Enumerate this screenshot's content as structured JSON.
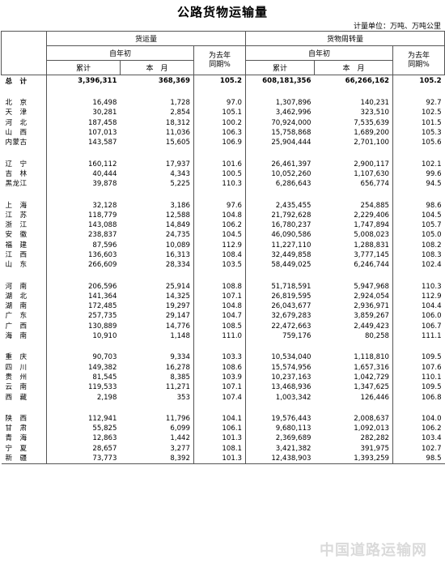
{
  "title": "公路货物运输量",
  "unit": "计量单位：万吨、万吨公里",
  "headers": {
    "freight": "货运量",
    "turnover": "货物周转量",
    "ytd_top": "自年初",
    "ytd_bottom": "累计",
    "month": "本　月",
    "yoy_top": "为去年",
    "yoy_bottom": "同期%"
  },
  "total": {
    "name": "总　计",
    "c1": "3,396,311",
    "c2": "368,369",
    "c3": "105.2",
    "c4": "608,181,356",
    "c5": "66,266,162",
    "c6": "105.2"
  },
  "groups": [
    [
      {
        "name": "北　京",
        "c1": "16,498",
        "c2": "1,728",
        "c3": "97.0",
        "c4": "1,307,896",
        "c5": "140,231",
        "c6": "92.7"
      },
      {
        "name": "天　津",
        "c1": "30,281",
        "c2": "2,854",
        "c3": "105.1",
        "c4": "3,462,996",
        "c5": "323,510",
        "c6": "102.5"
      },
      {
        "name": "河　北",
        "c1": "187,458",
        "c2": "18,312",
        "c3": "100.2",
        "c4": "70,924,000",
        "c5": "7,535,639",
        "c6": "101.5"
      },
      {
        "name": "山　西",
        "c1": "107,013",
        "c2": "11,036",
        "c3": "106.3",
        "c4": "15,758,868",
        "c5": "1,689,200",
        "c6": "105.3"
      },
      {
        "name": "内蒙古",
        "c1": "143,587",
        "c2": "15,605",
        "c3": "106.9",
        "c4": "25,904,444",
        "c5": "2,701,100",
        "c6": "105.6"
      }
    ],
    [
      {
        "name": "辽　宁",
        "c1": "160,112",
        "c2": "17,937",
        "c3": "101.6",
        "c4": "26,461,397",
        "c5": "2,900,117",
        "c6": "102.1"
      },
      {
        "name": "吉　林",
        "c1": "40,444",
        "c2": "4,343",
        "c3": "100.5",
        "c4": "10,052,260",
        "c5": "1,107,630",
        "c6": "99.6"
      },
      {
        "name": "黑龙江",
        "c1": "39,878",
        "c2": "5,225",
        "c3": "110.3",
        "c4": "6,286,643",
        "c5": "656,774",
        "c6": "94.5"
      }
    ],
    [
      {
        "name": "上　海",
        "c1": "32,128",
        "c2": "3,186",
        "c3": "97.6",
        "c4": "2,435,455",
        "c5": "254,885",
        "c6": "98.6"
      },
      {
        "name": "江　苏",
        "c1": "118,779",
        "c2": "12,588",
        "c3": "104.8",
        "c4": "21,792,628",
        "c5": "2,229,406",
        "c6": "104.5"
      },
      {
        "name": "浙　江",
        "c1": "143,088",
        "c2": "14,849",
        "c3": "106.2",
        "c4": "16,780,237",
        "c5": "1,747,894",
        "c6": "105.7"
      },
      {
        "name": "安　徽",
        "c1": "238,837",
        "c2": "24,735",
        "c3": "104.5",
        "c4": "46,090,586",
        "c5": "5,008,023",
        "c6": "105.0"
      },
      {
        "name": "福　建",
        "c1": "87,596",
        "c2": "10,089",
        "c3": "112.9",
        "c4": "11,227,110",
        "c5": "1,288,831",
        "c6": "108.2"
      },
      {
        "name": "江　西",
        "c1": "136,603",
        "c2": "16,313",
        "c3": "108.4",
        "c4": "32,449,858",
        "c5": "3,777,145",
        "c6": "108.3"
      },
      {
        "name": "山　东",
        "c1": "266,609",
        "c2": "28,334",
        "c3": "103.5",
        "c4": "58,449,025",
        "c5": "6,246,744",
        "c6": "102.4"
      }
    ],
    [
      {
        "name": "河　南",
        "c1": "206,596",
        "c2": "25,914",
        "c3": "108.8",
        "c4": "51,718,591",
        "c5": "5,947,968",
        "c6": "110.3"
      },
      {
        "name": "湖　北",
        "c1": "141,364",
        "c2": "14,325",
        "c3": "107.1",
        "c4": "26,819,595",
        "c5": "2,924,054",
        "c6": "112.9"
      },
      {
        "name": "湖　南",
        "c1": "172,485",
        "c2": "19,297",
        "c3": "104.8",
        "c4": "26,043,677",
        "c5": "2,936,971",
        "c6": "104.4"
      },
      {
        "name": "广　东",
        "c1": "257,735",
        "c2": "29,147",
        "c3": "104.7",
        "c4": "32,679,283",
        "c5": "3,859,267",
        "c6": "106.0"
      },
      {
        "name": "广　西",
        "c1": "130,889",
        "c2": "14,776",
        "c3": "108.5",
        "c4": "22,472,663",
        "c5": "2,449,423",
        "c6": "106.7"
      },
      {
        "name": "海　南",
        "c1": "10,910",
        "c2": "1,148",
        "c3": "111.0",
        "c4": "759,176",
        "c5": "80,258",
        "c6": "111.1"
      }
    ],
    [
      {
        "name": "重　庆",
        "c1": "90,703",
        "c2": "9,334",
        "c3": "103.3",
        "c4": "10,534,040",
        "c5": "1,118,810",
        "c6": "109.5"
      },
      {
        "name": "四　川",
        "c1": "149,382",
        "c2": "16,278",
        "c3": "108.6",
        "c4": "15,574,956",
        "c5": "1,657,316",
        "c6": "107.6"
      },
      {
        "name": "贵　州",
        "c1": "81,545",
        "c2": "8,385",
        "c3": "103.9",
        "c4": "10,237,163",
        "c5": "1,042,729",
        "c6": "110.1"
      },
      {
        "name": "云　南",
        "c1": "119,533",
        "c2": "11,271",
        "c3": "107.1",
        "c4": "13,468,936",
        "c5": "1,347,625",
        "c6": "109.5"
      },
      {
        "name": "西　藏",
        "c1": "2,198",
        "c2": "353",
        "c3": "107.4",
        "c4": "1,003,342",
        "c5": "126,446",
        "c6": "106.8"
      }
    ],
    [
      {
        "name": "陕　西",
        "c1": "112,941",
        "c2": "11,796",
        "c3": "104.1",
        "c4": "19,576,443",
        "c5": "2,008,637",
        "c6": "104.0"
      },
      {
        "name": "甘　肃",
        "c1": "55,825",
        "c2": "6,099",
        "c3": "106.1",
        "c4": "9,680,113",
        "c5": "1,092,013",
        "c6": "106.2"
      },
      {
        "name": "青　海",
        "c1": "12,863",
        "c2": "1,442",
        "c3": "101.3",
        "c4": "2,369,689",
        "c5": "282,282",
        "c6": "103.4"
      },
      {
        "name": "宁　夏",
        "c1": "28,657",
        "c2": "3,277",
        "c3": "108.1",
        "c4": "3,421,382",
        "c5": "391,975",
        "c6": "102.7"
      },
      {
        "name": "新　疆",
        "c1": "73,773",
        "c2": "8,392",
        "c3": "101.3",
        "c4": "12,438,903",
        "c5": "1,393,259",
        "c6": "98.5"
      }
    ]
  ],
  "watermark": "中国道路运输网"
}
